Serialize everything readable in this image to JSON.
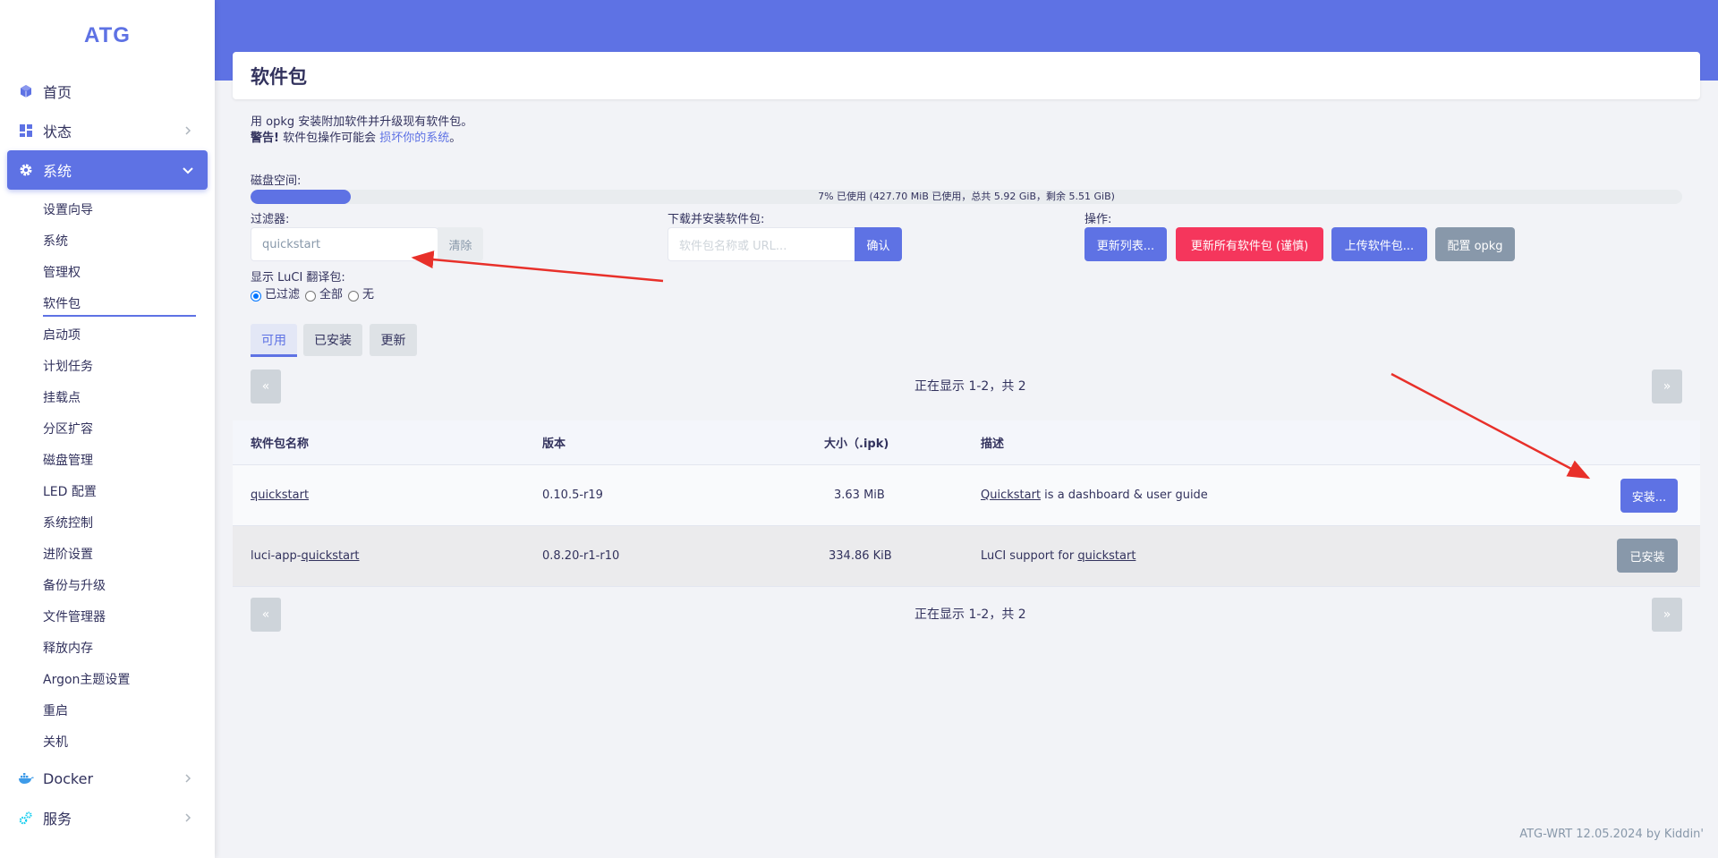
{
  "sidebar": {
    "logo": "ATG",
    "items": [
      {
        "label": "首页",
        "icon": "cube-icon",
        "expandable": false
      },
      {
        "label": "状态",
        "icon": "dashboard-icon",
        "expandable": true
      },
      {
        "label": "系统",
        "icon": "gear-icon",
        "expandable": true,
        "active": true
      }
    ],
    "sub_items": [
      "设置向导",
      "系统",
      "管理权",
      "软件包",
      "启动项",
      "计划任务",
      "挂载点",
      "分区扩容",
      "磁盘管理",
      "LED 配置",
      "系统控制",
      "进阶设置",
      "备份与升级",
      "文件管理器",
      "释放内存",
      "Argon主题设置",
      "重启",
      "关机"
    ],
    "current_sub": "软件包",
    "items_after": [
      {
        "label": "Docker",
        "icon": "docker-icon"
      },
      {
        "label": "服务",
        "icon": "services-icon"
      }
    ]
  },
  "page": {
    "title": "软件包",
    "desc_line1": "用 opkg 安装附加软件并升级现有软件包。",
    "warning_strong": "警告!",
    "warning_text": " 软件包操作可能会 ",
    "warning_link": "损坏你的系统",
    "warning_end": "。"
  },
  "disk": {
    "label": "磁盘空间:",
    "used_fraction": 0.07,
    "text": "7% 已使用 (427.70 MiB 已使用，总共 5.92 GiB，剩余 5.51 GiB)"
  },
  "filter": {
    "label": "过滤器:",
    "value": "quickstart",
    "clear_label": "清除"
  },
  "download": {
    "label": "下载并安装软件包:",
    "placeholder": "软件包名称或 URL...",
    "confirm_label": "确认"
  },
  "actions": {
    "label": "操作:",
    "update_lists": "更新列表...",
    "upgrade_all": "更新所有软件包 (谨慎)",
    "upload": "上传软件包...",
    "configure": "配置 opkg"
  },
  "luci_translation": {
    "label": "显示 LuCI 翻译包:",
    "options": [
      "已过滤",
      "全部",
      "无"
    ],
    "selected": "已过滤"
  },
  "tabs": [
    "可用",
    "已安装",
    "更新"
  ],
  "active_tab": "可用",
  "pager": {
    "prev": "«",
    "next": "»",
    "text": "正在显示 1-2，共 2"
  },
  "table": {
    "headers": [
      "软件包名称",
      "版本",
      "大小（.ipk)",
      "描述"
    ],
    "rows": [
      {
        "name": "quickstart",
        "version": "0.10.5-r19",
        "size": "3.63 MiB",
        "desc_prefix": "",
        "desc_link": "Quickstart",
        "desc_suffix": " is a dashboard & user guide",
        "action": "安装..."
      },
      {
        "name_prefix": "luci-app-",
        "name_link": "quickstart",
        "version": "0.8.20-r1-r10",
        "size": "334.86 KiB",
        "desc_prefix": "LuCI support for ",
        "desc_link": "quickstart",
        "desc_suffix": "",
        "action": "已安装"
      }
    ]
  },
  "footer": "ATG-WRT 12.05.2024 by Kiddin'",
  "colors": {
    "primary": "#5e72e4",
    "danger": "#f5365c",
    "secondary": "#8898aa",
    "annotation_arrow": "#e8302a"
  }
}
